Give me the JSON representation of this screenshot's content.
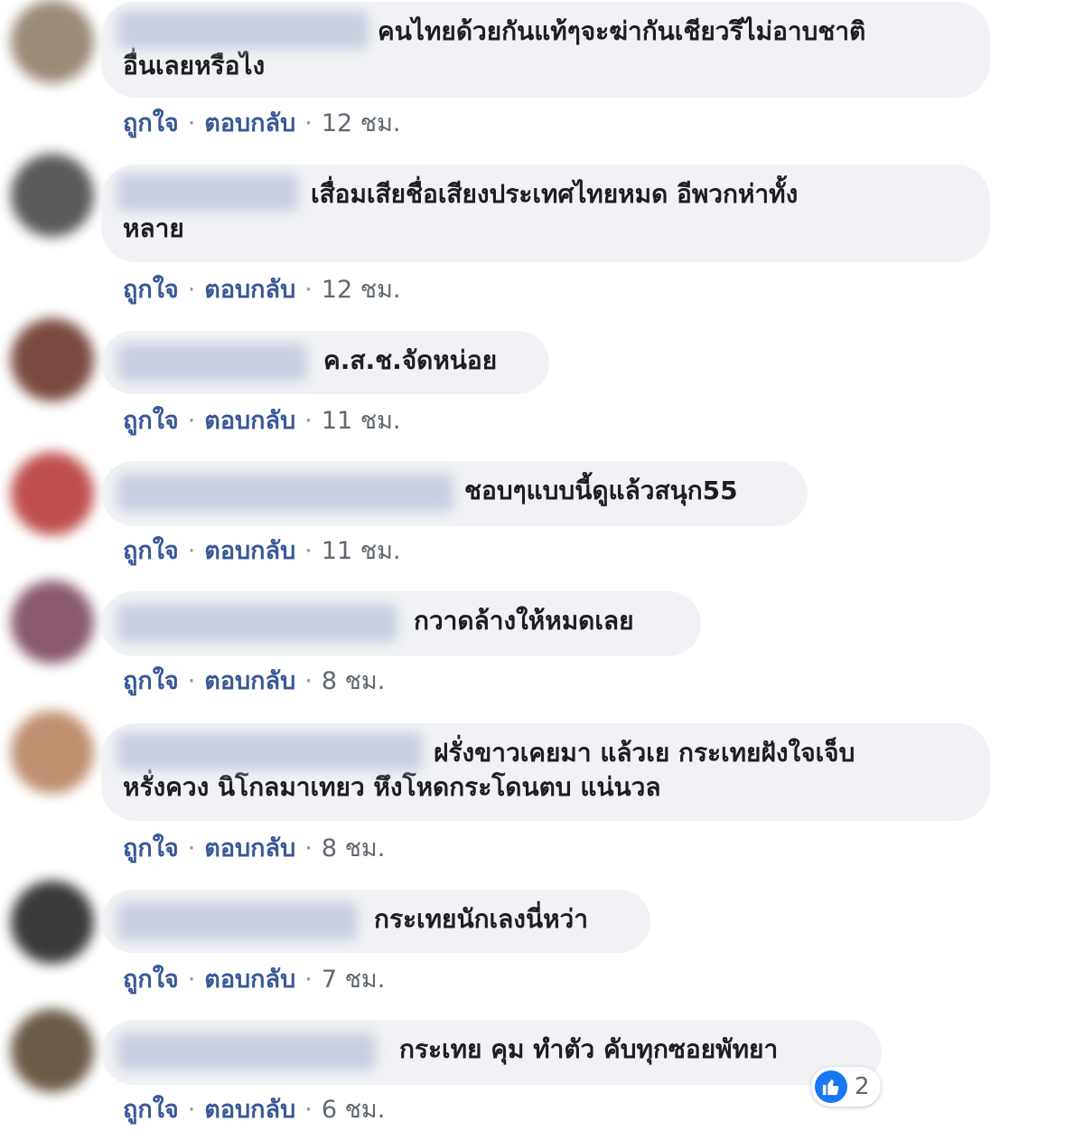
{
  "actions": {
    "like": "ถูกใจ",
    "reply": "ตอบกลับ",
    "separator": "·"
  },
  "comments": [
    {
      "text": "คนไทยด้วยกันแท้ๆจะฆ่ากันเชียวรึไม่อาบชาติ\nอื่นเลยหรือไง",
      "time": "12 ชม.",
      "avatar_color": "#9a8a78"
    },
    {
      "text": "เสื่อมเสียชื่อเสียงประเทศไทยหมด อีพวกห่าทั้ง\nหลาย",
      "time": "12 ชม.",
      "avatar_color": "#5a5a5a"
    },
    {
      "text": "ค.ส.ช.จัดหน่อย",
      "time": "11 ชม.",
      "avatar_color": "#7a4a40"
    },
    {
      "text": "ชอบๆแบบนี้ดูแล้วสนุก55",
      "time": "11 ชม.",
      "avatar_color": "#c05050"
    },
    {
      "text": "กวาดล้างให้หมดเลย",
      "time": "8 ชม.",
      "avatar_color": "#8a5a70"
    },
    {
      "text": "ฝรั่งขาวเคยมา แล้วเย กระเทยฝังใจเจ็บ\nหรั่งควง นิโกลมาเทยว หึงโหดกระโดนตบ แน่นวล",
      "time": "8 ชม.",
      "avatar_color": "#c09070"
    },
    {
      "text": "กระเทยนักเลงนี่หว่า",
      "time": "7 ชม.",
      "avatar_color": "#3a3a3a"
    },
    {
      "text": "กระเทย คุม ทำตัว คับทุกซอยพัทยา",
      "time": "6 ชม.",
      "avatar_color": "#6a5a48",
      "reaction_count": "2"
    }
  ]
}
